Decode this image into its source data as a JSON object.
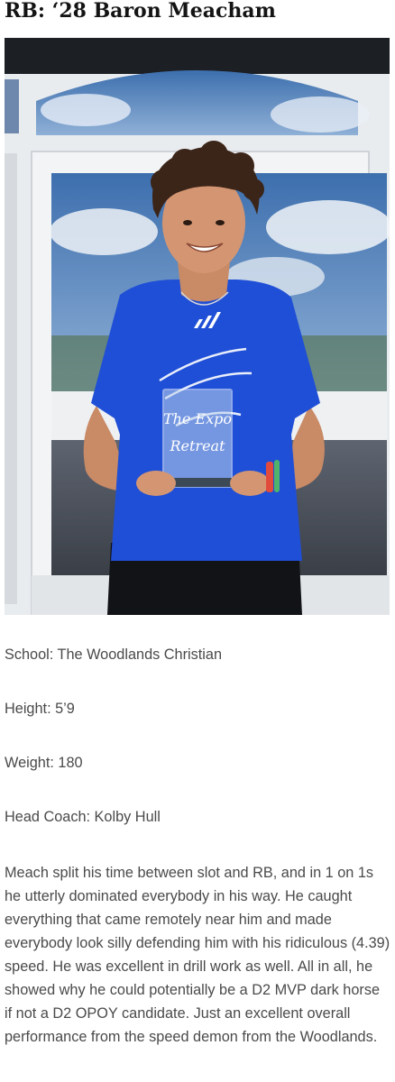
{
  "article": {
    "title": "RB: ‘28 Baron Meacham",
    "photo": {
      "alt": "Player holding trophy",
      "shirt_color": "#1f4fd6",
      "trophy_text_line1": "The Expo",
      "trophy_text_line2": "Retreat"
    },
    "details": {
      "school": "School: The Woodlands Christian",
      "height": "Height: 5’9",
      "weight": "Weight: 180",
      "coach": "Head Coach: Kolby Hull"
    },
    "description": "Meach split his time between slot and RB, and in 1 on 1s he utterly dominated everybody in his way. He caught everything that came remotely near him and made everybody look silly defending him with his ridiculous (4.39) speed. He was excellent in drill work as well. All in all, he showed why he could potentially be a D2 MVP dark horse if not a D2 OPOY candidate. Just an excellent overall performance from the speed demon from the Woodlands."
  }
}
